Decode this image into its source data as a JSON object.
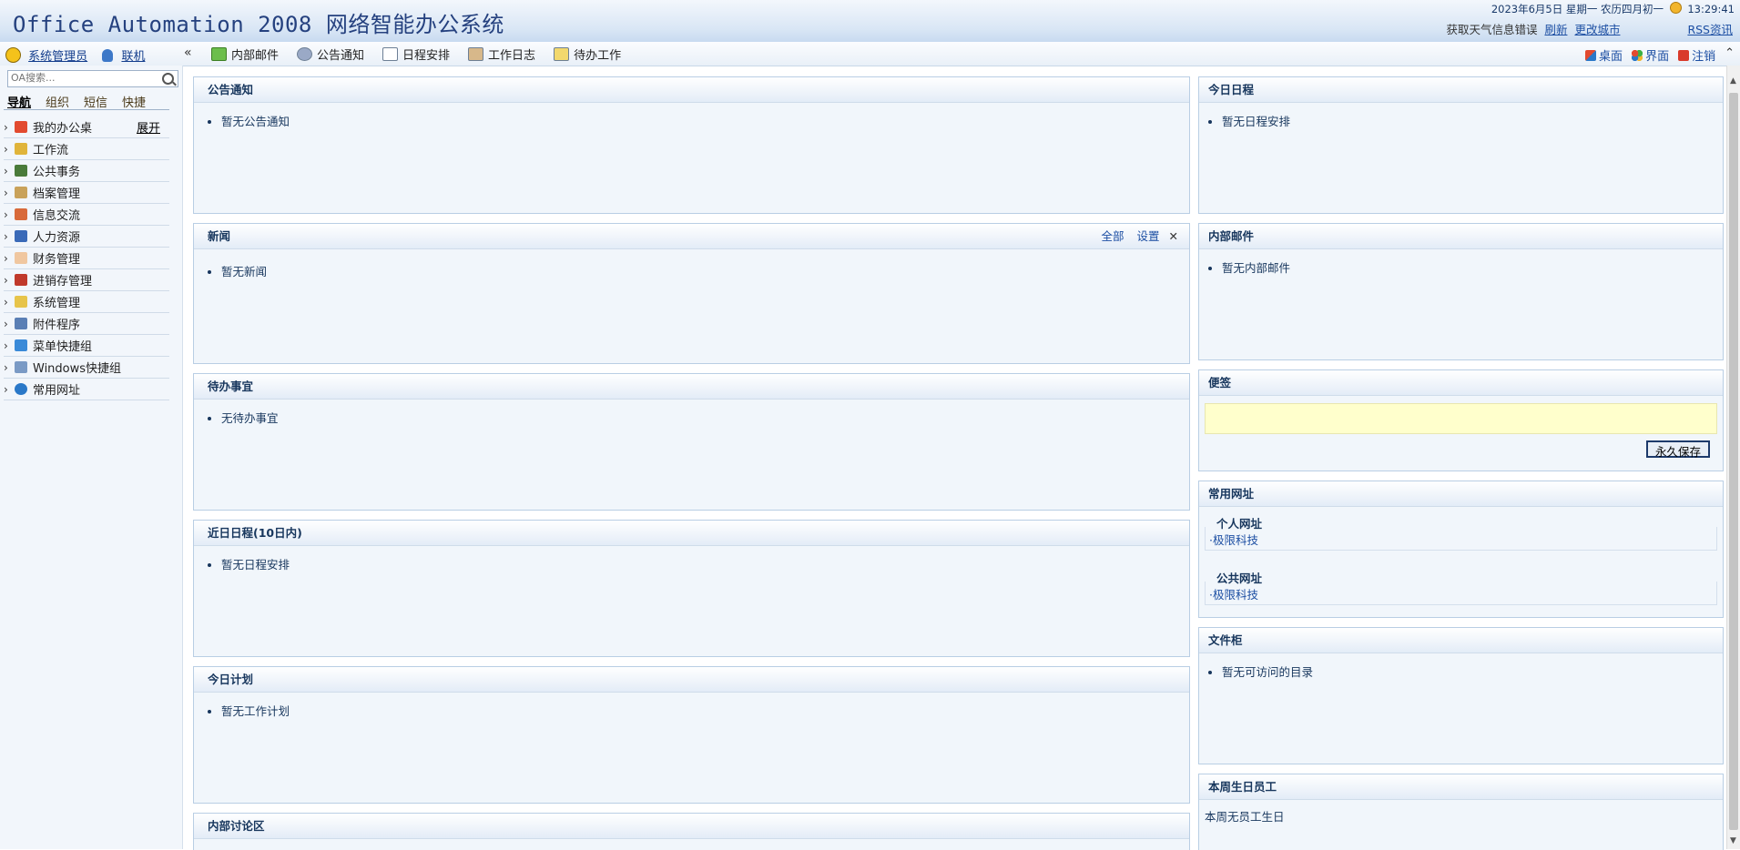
{
  "header": {
    "app_title": "Office Automation 2008 网络智能办公系统",
    "date_text": "2023年6月5日  星期一  农历四月初一",
    "time_text": "13:29:41",
    "weather_error": "获取天气信息错误",
    "refresh_link": "刷新",
    "change_city_link": "更改城市",
    "rss_link": "RSS资讯"
  },
  "toolbar": {
    "user_name": "系统管理员",
    "status": "联机",
    "collapse_symbol": "«",
    "items": [
      {
        "label": "内部邮件",
        "icon": "mail-icon"
      },
      {
        "label": "公告通知",
        "icon": "notice-icon"
      },
      {
        "label": "日程安排",
        "icon": "calendar-icon"
      },
      {
        "label": "工作日志",
        "icon": "log-icon"
      },
      {
        "label": "待办工作",
        "icon": "todo-icon"
      }
    ],
    "right_links": [
      {
        "label": "桌面",
        "icon": "desktop-icon"
      },
      {
        "label": "界面",
        "icon": "theme-icon"
      },
      {
        "label": "注销",
        "icon": "logout-icon"
      }
    ]
  },
  "sidebar": {
    "search_placeholder": "OA搜索...",
    "tabs": [
      "导航",
      "组织",
      "短信",
      "快捷"
    ],
    "expand_label": "展开",
    "items": [
      {
        "label": "我的办公桌",
        "color": "#e24a2f"
      },
      {
        "label": "工作流",
        "color": "#e0b43a"
      },
      {
        "label": "公共事务",
        "color": "#4a7b3a"
      },
      {
        "label": "档案管理",
        "color": "#c9a25a"
      },
      {
        "label": "信息交流",
        "color": "#d86a3a"
      },
      {
        "label": "人力资源",
        "color": "#3a6ab8"
      },
      {
        "label": "财务管理",
        "color": "#f0c7a0"
      },
      {
        "label": "进销存管理",
        "color": "#c0392b"
      },
      {
        "label": "系统管理",
        "color": "#e7c44a"
      },
      {
        "label": "附件程序",
        "color": "#5a7fb5"
      },
      {
        "label": "菜单快捷组",
        "color": "#3a8ad8"
      },
      {
        "label": "Windows快捷组",
        "color": "#7a9ac5"
      },
      {
        "label": "常用网址",
        "color": "#2a78c8"
      }
    ]
  },
  "panels": {
    "announcement": {
      "title": "公告通知",
      "items": [
        "暂无公告通知"
      ]
    },
    "news": {
      "title": "新闻",
      "all_link": "全部",
      "settings_link": "设置",
      "close_symbol": "✕",
      "items": [
        "暂无新闻"
      ]
    },
    "todo": {
      "title": "待办事宜",
      "items": [
        "无待办事宜"
      ]
    },
    "recent_schedule": {
      "title": "近日日程(10日内)",
      "items": [
        "暂无日程安排"
      ]
    },
    "today_plan": {
      "title": "今日计划",
      "items": [
        "暂无工作计划"
      ]
    },
    "forum": {
      "title": "内部讨论区"
    },
    "today_schedule": {
      "title": "今日日程",
      "items": [
        "暂无日程安排"
      ]
    },
    "internal_mail": {
      "title": "内部邮件",
      "items": [
        "暂无内部邮件"
      ]
    },
    "notes": {
      "title": "便签",
      "save_label": "永久保存"
    },
    "websites": {
      "title": "常用网址",
      "personal_title": "个人网址",
      "personal_link": "·极限科技",
      "public_title": "公共网址",
      "public_link": "·极限科技"
    },
    "file_cabinet": {
      "title": "文件柜",
      "items": [
        "暂无可访问的目录"
      ]
    },
    "birthday": {
      "title": "本周生日员工",
      "text": "本周无员工生日"
    }
  }
}
